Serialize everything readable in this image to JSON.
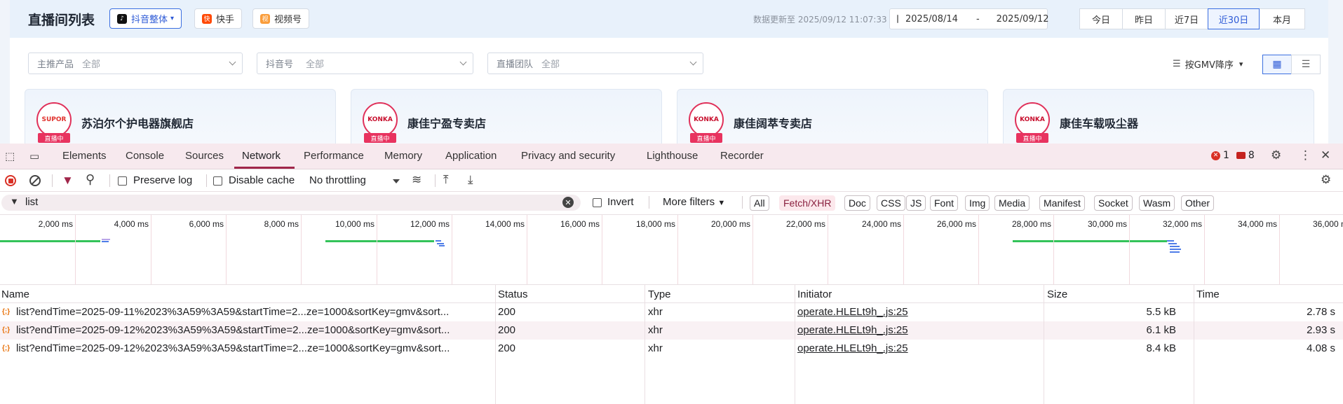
{
  "app": {
    "title": "直播间列表",
    "platforms": [
      {
        "label": "抖音整体",
        "active": true,
        "logo_bg": "#111111",
        "logo": "♪",
        "chev": "⌄"
      },
      {
        "label": "快手",
        "active": false,
        "logo_bg": "#ff4906",
        "logo": "快"
      },
      {
        "label": "视频号",
        "active": false,
        "logo_bg": "#fa9d3b",
        "logo": "视"
      }
    ],
    "update_text": "数据更新至 2025/09/12 11:07:33",
    "date_start": "2025/08/14",
    "date_sep": "-",
    "date_end": "2025/09/12",
    "ranges": [
      {
        "label": "今日",
        "active": false
      },
      {
        "label": "昨日",
        "active": false
      },
      {
        "label": "近7日",
        "active": false
      },
      {
        "label": "近30日",
        "active": true
      },
      {
        "label": "本月",
        "active": false
      }
    ],
    "filters": [
      {
        "label": "主推产品",
        "value": "全部"
      },
      {
        "label": "抖音号",
        "value": "全部"
      },
      {
        "label": "直播团队",
        "value": "全部"
      }
    ],
    "sort_label": "按GMV降序",
    "stores": [
      {
        "name": "苏泊尔个护电器旗舰店",
        "logo": "SUPOR",
        "logo_color": "#e0312d",
        "badge": "直播中"
      },
      {
        "name": "康佳宁盈专卖店",
        "logo": "KONKA",
        "logo_color": "#c8102e",
        "badge": "直播中"
      },
      {
        "name": "康佳阔萃专卖店",
        "logo": "KONKA",
        "logo_color": "#c8102e",
        "badge": "直播中"
      },
      {
        "name": "康佳车载吸尘器",
        "logo": "KONKA",
        "logo_color": "#c8102e",
        "badge": "直播中"
      }
    ]
  },
  "devtools": {
    "tabs": [
      "Elements",
      "Console",
      "Sources",
      "Network",
      "Performance",
      "Memory",
      "Application",
      "Privacy and security",
      "Lighthouse",
      "Recorder"
    ],
    "active_tab": "Network",
    "error_count": "1",
    "message_count": "8",
    "toolbar": {
      "preserve_log": "Preserve log",
      "disable_cache": "Disable cache",
      "throttling": "No throttling"
    },
    "filter": {
      "value": "list",
      "invert": "Invert",
      "more_filters": "More filters",
      "types": [
        {
          "label": "All",
          "active": false
        },
        {
          "label": "Fetch/XHR",
          "active": true
        },
        {
          "label": "Doc",
          "active": false
        },
        {
          "label": "CSS",
          "active": false
        },
        {
          "label": "JS",
          "active": false
        },
        {
          "label": "Font",
          "active": false
        },
        {
          "label": "Img",
          "active": false
        },
        {
          "label": "Media",
          "active": false
        },
        {
          "label": "Manifest",
          "active": false
        },
        {
          "label": "Socket",
          "active": false
        },
        {
          "label": "Wasm",
          "active": false
        },
        {
          "label": "Other",
          "active": false
        }
      ]
    },
    "timeline_ticks": [
      "2,000 ms",
      "4,000 ms",
      "6,000 ms",
      "8,000 ms",
      "10,000 ms",
      "12,000 ms",
      "14,000 ms",
      "16,000 ms",
      "18,000 ms",
      "20,000 ms",
      "22,000 ms",
      "24,000 ms",
      "26,000 ms",
      "28,000 ms",
      "30,000 ms",
      "32,000 ms",
      "34,000 ms",
      "36,000 ms"
    ],
    "columns": [
      "Name",
      "Status",
      "Type",
      "Initiator",
      "Size",
      "Time"
    ],
    "rows": [
      {
        "name": "list?endTime=2025-09-11%2023%3A59%3A59&startTime=2...ze=1000&sortKey=gmv&sort...",
        "status": "200",
        "type": "xhr",
        "initiator": "operate.HLELt9h_.js:25",
        "size": "5.5 kB",
        "time": "2.78 s"
      },
      {
        "name": "list?endTime=2025-09-12%2023%3A59%3A59&startTime=2...ze=1000&sortKey=gmv&sort...",
        "status": "200",
        "type": "xhr",
        "initiator": "operate.HLELt9h_.js:25",
        "size": "6.1 kB",
        "time": "2.93 s"
      },
      {
        "name": "list?endTime=2025-09-12%2023%3A59%3A59&startTime=2...ze=1000&sortKey=gmv&sort...",
        "status": "200",
        "type": "xhr",
        "initiator": "operate.HLELt9h_.js:25",
        "size": "8.4 kB",
        "time": "4.08 s"
      }
    ]
  }
}
